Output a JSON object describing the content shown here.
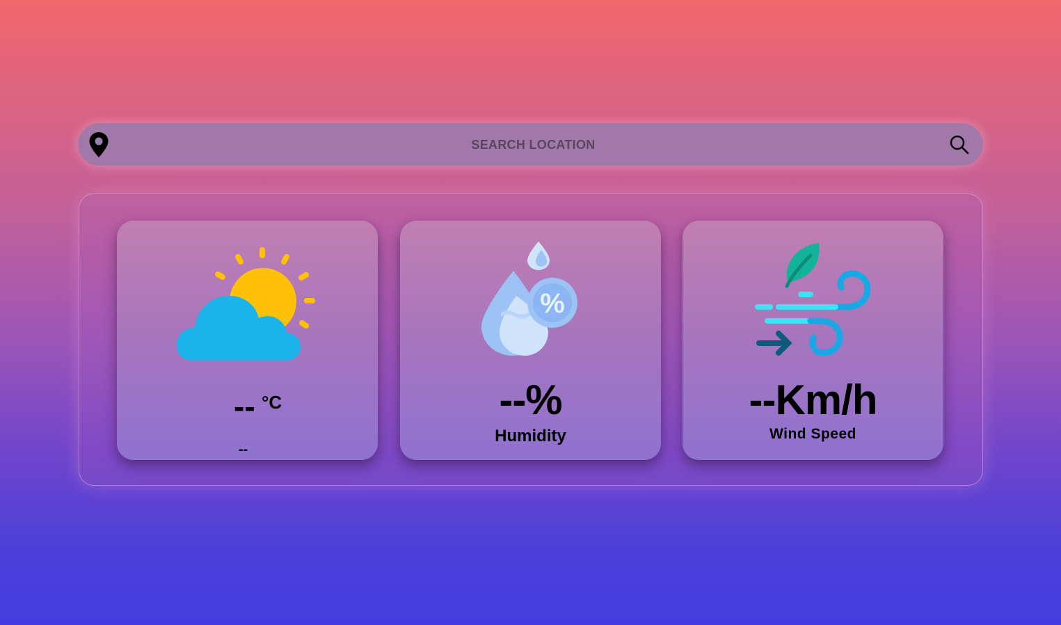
{
  "search": {
    "placeholder": "SEARCH LOCATION",
    "location_icon": "location-pin-icon",
    "search_icon": "magnifier-icon"
  },
  "weather": {
    "temperature": {
      "value": "--",
      "unit": "°C",
      "description": "--",
      "icon": "partly-cloudy-icon"
    },
    "humidity": {
      "value": "--%",
      "label": "Humidity",
      "icon": "humidity-drops-icon"
    },
    "wind": {
      "value": "--Km/h",
      "label": "Wind Speed",
      "icon": "wind-leaf-icon"
    }
  },
  "colors": {
    "sun": "#ffc107",
    "cloud": "#1bb3ea",
    "drop_light": "#cfe3fb",
    "drop_mid": "#9dc3f5",
    "leaf": "#12b39a",
    "wind_cyan": "#3ee2f2",
    "wind_blue": "#1aa7e6",
    "arrow": "#0e5a7c"
  }
}
